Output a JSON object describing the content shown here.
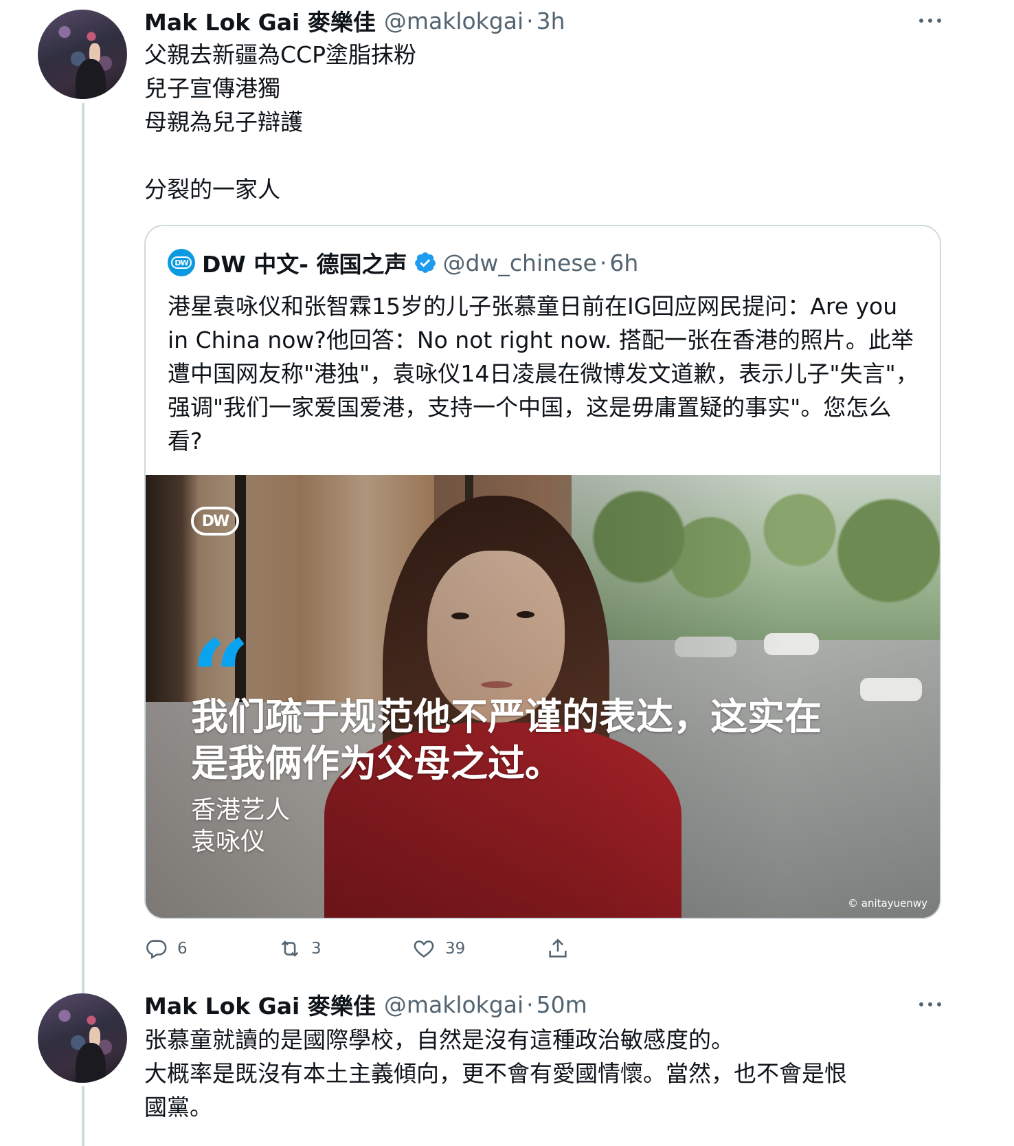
{
  "tweet1": {
    "display_name": "Mak Lok Gai 麥樂佳",
    "handle": "@maklokgai",
    "separator": "·",
    "time": "3h",
    "text": "父親去新疆為CCP塗脂抹粉\n兒子宣傳港獨\n母親為兒子辯護\n\n分裂的一家人",
    "avatar_icon": "avatar-crowd-photo",
    "more_icon": "more-horizontal-icon"
  },
  "quote": {
    "display_name": "DW 中文- 德国之声",
    "verified_icon": "verified-badge-icon",
    "verified_color": "#1d9bf0",
    "handle": "@dw_chinese",
    "separator": "·",
    "time": "6h",
    "text": "港星袁咏仪和张智霖15岁的儿子张慕童日前在IG回应网民提问：Are you in China now?他回答：No not right now. 搭配一张在香港的照片。此举遭中国网友称\"港独\"，袁咏仪14日凌晨在微博发文道歉，表示儿子\"失言\"，强调\"我们一家爱国爱港，支持一个中国，这是毋庸置疑的事实\"。您怎么看?",
    "avatar_label": "DW",
    "media": {
      "logo": "DW",
      "quote_mark": "“",
      "quote_line1": "我们疏于规范他不严谨的表达，这实在",
      "quote_line2": "是我俩作为父母之过。",
      "attribution_line1": "香港艺人",
      "attribution_line2": "袁咏仪",
      "credit": "© anitayuenwy",
      "accent_color": "#0aa3f0"
    }
  },
  "actions": {
    "reply": {
      "icon": "reply-icon",
      "count": "6"
    },
    "retweet": {
      "icon": "retweet-icon",
      "count": "3"
    },
    "like": {
      "icon": "like-heart-icon",
      "count": "39"
    },
    "share": {
      "icon": "share-icon"
    }
  },
  "tweet2": {
    "display_name": "Mak Lok Gai 麥樂佳",
    "handle": "@maklokgai",
    "separator": "·",
    "time": "50m",
    "text": "张慕童就讀的是國際學校，自然是沒有這種政治敏感度的。\n大概率是既沒有本土主義傾向，更不會有愛國情懷。當然，也不會是恨\n國黨。",
    "avatar_icon": "avatar-crowd-photo",
    "more_icon": "more-horizontal-icon"
  },
  "colors": {
    "text_primary": "#0f1419",
    "text_secondary": "#536471",
    "border": "#cfd9de"
  }
}
